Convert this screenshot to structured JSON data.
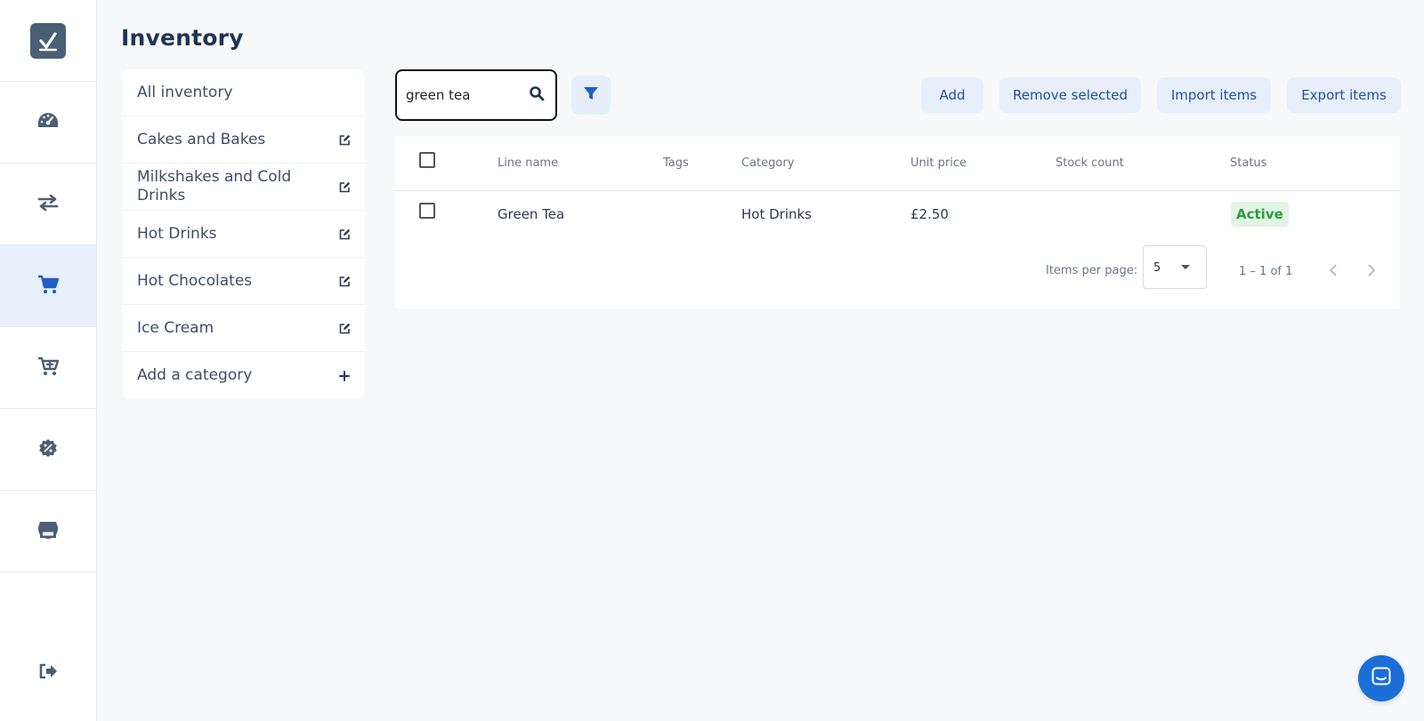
{
  "page": {
    "title": "Inventory"
  },
  "rail": {
    "items": [
      {
        "icon": "logo-check-icon"
      },
      {
        "icon": "dashboard-gauge-icon"
      },
      {
        "icon": "transactions-arrows-icon"
      },
      {
        "icon": "cart-icon",
        "active": true
      },
      {
        "icon": "cart-plus-icon"
      },
      {
        "icon": "discount-badge-icon"
      },
      {
        "icon": "store-icon"
      }
    ],
    "logout_icon": "logout-icon"
  },
  "categories": {
    "all_label": "All inventory",
    "items": [
      {
        "label": "Cakes and Bakes"
      },
      {
        "label": "Milkshakes and Cold Drinks"
      },
      {
        "label": "Hot Drinks"
      },
      {
        "label": "Hot Chocolates"
      },
      {
        "label": "Ice Cream"
      }
    ],
    "add_label": "Add a category"
  },
  "toolbar": {
    "search_value": "green tea",
    "add_label": "Add",
    "remove_label": "Remove selected",
    "import_label": "Import items",
    "export_label": "Export items"
  },
  "table": {
    "headers": {
      "line_name": "Line name",
      "tags": "Tags",
      "category": "Category",
      "unit_price": "Unit price",
      "stock_count": "Stock count",
      "status": "Status"
    },
    "rows": [
      {
        "line_name": "Green Tea",
        "tags": "",
        "category": "Hot Drinks",
        "unit_price": "£2.50",
        "stock_count": "",
        "status": "Active"
      }
    ]
  },
  "pagination": {
    "items_per_page_label": "Items per page:",
    "items_per_page_value": "5",
    "range": "1 – 1 of 1"
  },
  "colors": {
    "accent": "#1b6ed8",
    "rail_icon": "#4a5f74",
    "active_rail_icon": "#1d5fc4",
    "status_active_bg": "#e2f5e5",
    "status_active_text": "#2e9a46"
  }
}
